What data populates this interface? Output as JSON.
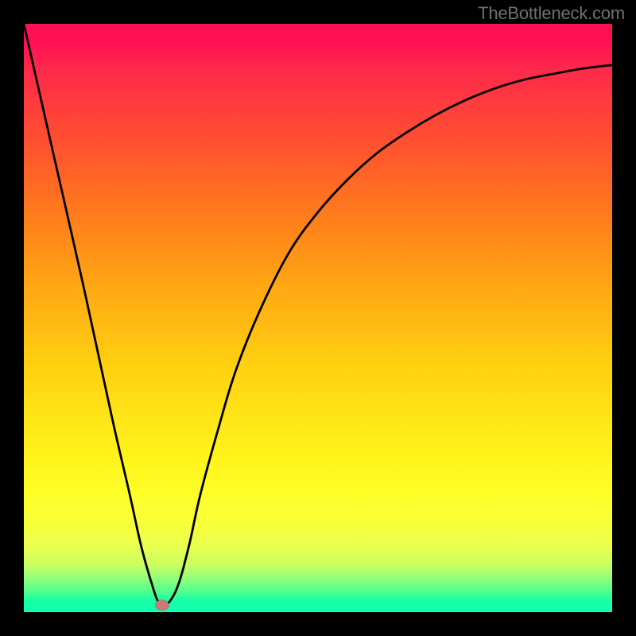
{
  "watermark": "TheBottleneck.com",
  "chart_data": {
    "type": "line",
    "title": "",
    "xlabel": "",
    "ylabel": "",
    "xlim": [
      0,
      100
    ],
    "ylim": [
      0,
      100
    ],
    "grid": false,
    "legend": false,
    "note": "Axes and ticks are not labeled; values are approximate positions read from the figure in percentage-of-plot units. Low y-values correspond to the green (good) region, high y-values to the red region.",
    "series": [
      {
        "name": "bottleneck-curve",
        "x": [
          0,
          5,
          10,
          15,
          18,
          20,
          22,
          23,
          24,
          26,
          28,
          30,
          33,
          36,
          40,
          45,
          50,
          55,
          60,
          65,
          70,
          75,
          80,
          85,
          90,
          95,
          100
        ],
        "y": [
          100,
          78,
          56,
          33,
          20,
          11,
          4,
          1.5,
          1,
          4,
          11,
          20,
          31,
          41,
          51,
          61,
          68,
          73.5,
          78,
          81.5,
          84.5,
          87,
          89,
          90.5,
          91.5,
          92.4,
          93
        ]
      }
    ],
    "marker_point": {
      "x": 23.5,
      "y": 1.2
    },
    "gradient_stops": [
      {
        "pos": 0.0,
        "color": "#ff1054"
      },
      {
        "pos": 0.2,
        "color": "#ff5030"
      },
      {
        "pos": 0.45,
        "color": "#ffa813"
      },
      {
        "pos": 0.72,
        "color": "#fff019"
      },
      {
        "pos": 0.88,
        "color": "#e0ff50"
      },
      {
        "pos": 1.0,
        "color": "#10ffb4"
      }
    ]
  }
}
